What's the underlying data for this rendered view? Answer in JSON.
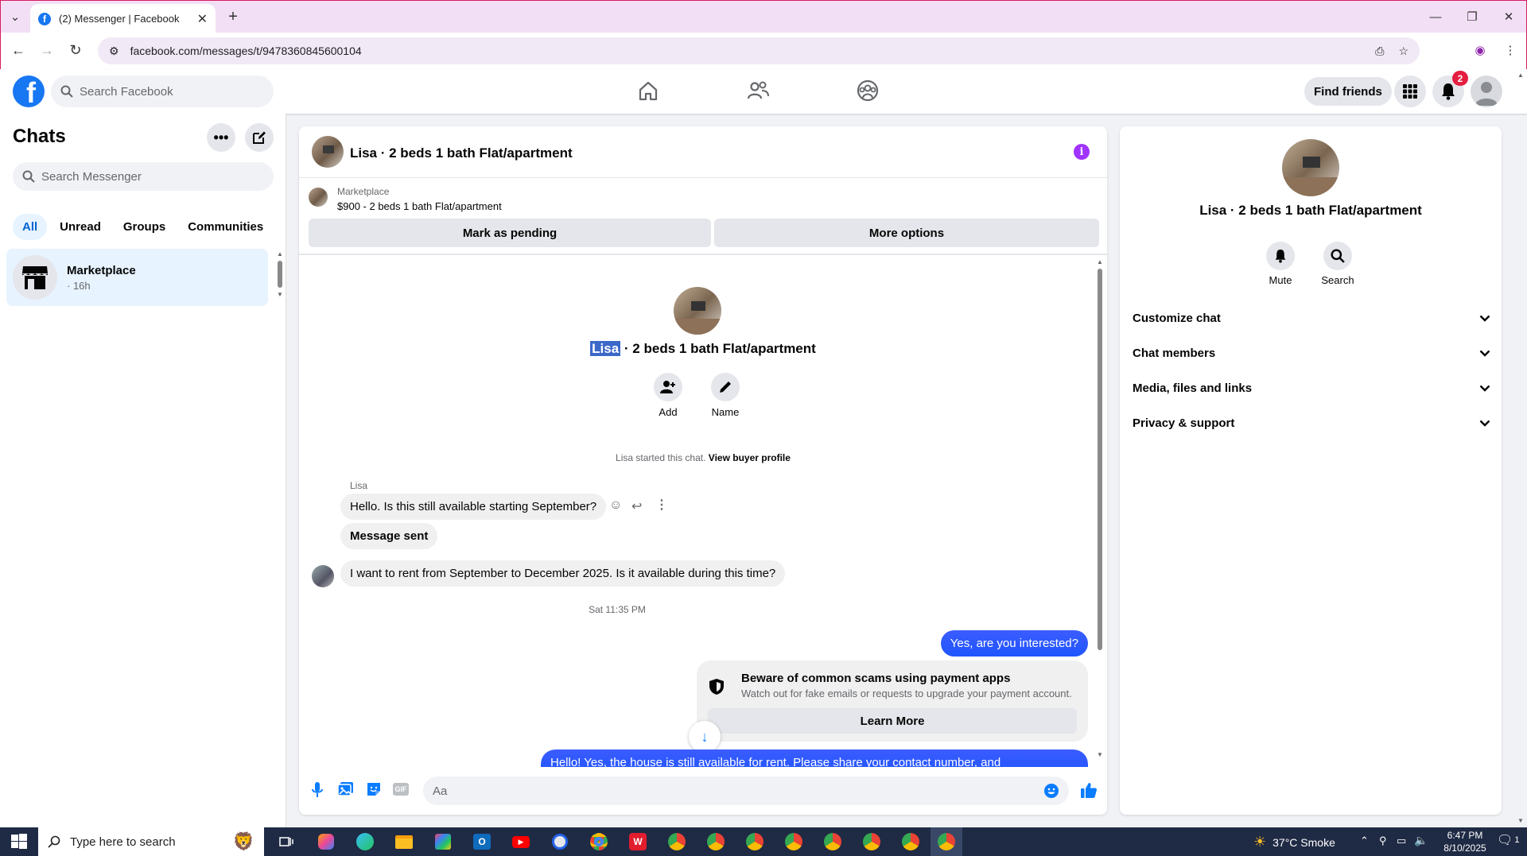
{
  "browser": {
    "tab_title": "(2) Messenger | Facebook",
    "new_tab_symbol": "+",
    "url": "facebook.com/messages/t/9478360845600104"
  },
  "header": {
    "search_placeholder": "Search Facebook",
    "find_friends": "Find friends",
    "notification_count": "2"
  },
  "sidebar": {
    "title": "Chats",
    "search_placeholder": "Search Messenger",
    "filters": [
      "All",
      "Unread",
      "Groups",
      "Communities"
    ],
    "active_filter": "All",
    "chats": [
      {
        "name": "Marketplace",
        "meta": "· 16h"
      }
    ]
  },
  "conversation": {
    "title": "Lisa · 2 beds 1 bath Flat/apartment",
    "listing": {
      "source": "Marketplace",
      "summary": "$900 - 2 beds 1 bath Flat/apartment"
    },
    "actions": {
      "mark_pending": "Mark as pending",
      "more_options": "More options"
    },
    "profile": {
      "name_highlight": "Lisa",
      "name_rest": " · 2 beds 1 bath Flat/apartment",
      "add_label": "Add",
      "name_label": "Name"
    },
    "started_note": "Lisa started this chat.",
    "view_buyer_profile": "View buyer profile",
    "sender_label": "Lisa",
    "messages_in": [
      "Hello. Is this still available starting September?",
      "Message sent",
      "I want to rent from September to December 2025. Is it available during this time?"
    ],
    "timestamp": "Sat 11:35 PM",
    "messages_out": [
      "Yes, are you interested?",
      "Hello! Yes, the house is still available for rent. Please share your contact number, and"
    ],
    "scam_notice": {
      "title": "Beware of common scams using payment apps",
      "body": "Watch out for fake emails or requests to upgrade your payment account.",
      "button": "Learn More"
    },
    "composer_placeholder": "Aa"
  },
  "details": {
    "title": "Lisa · 2 beds 1 bath Flat/apartment",
    "mute": "Mute",
    "search": "Search",
    "sections": [
      "Customize chat",
      "Chat members",
      "Media, files and links",
      "Privacy & support"
    ]
  },
  "taskbar": {
    "search_placeholder": "Type here to search",
    "weather": "37°C  Smoke",
    "time": "6:47 PM",
    "date": "8/10/2025",
    "notif_count": "1"
  },
  "colors": {
    "facebook_blue": "#1877f2",
    "messenger_purple": "#a033ff",
    "bubble_blue": "#2b5bff",
    "notification_red": "#e41e3f"
  }
}
